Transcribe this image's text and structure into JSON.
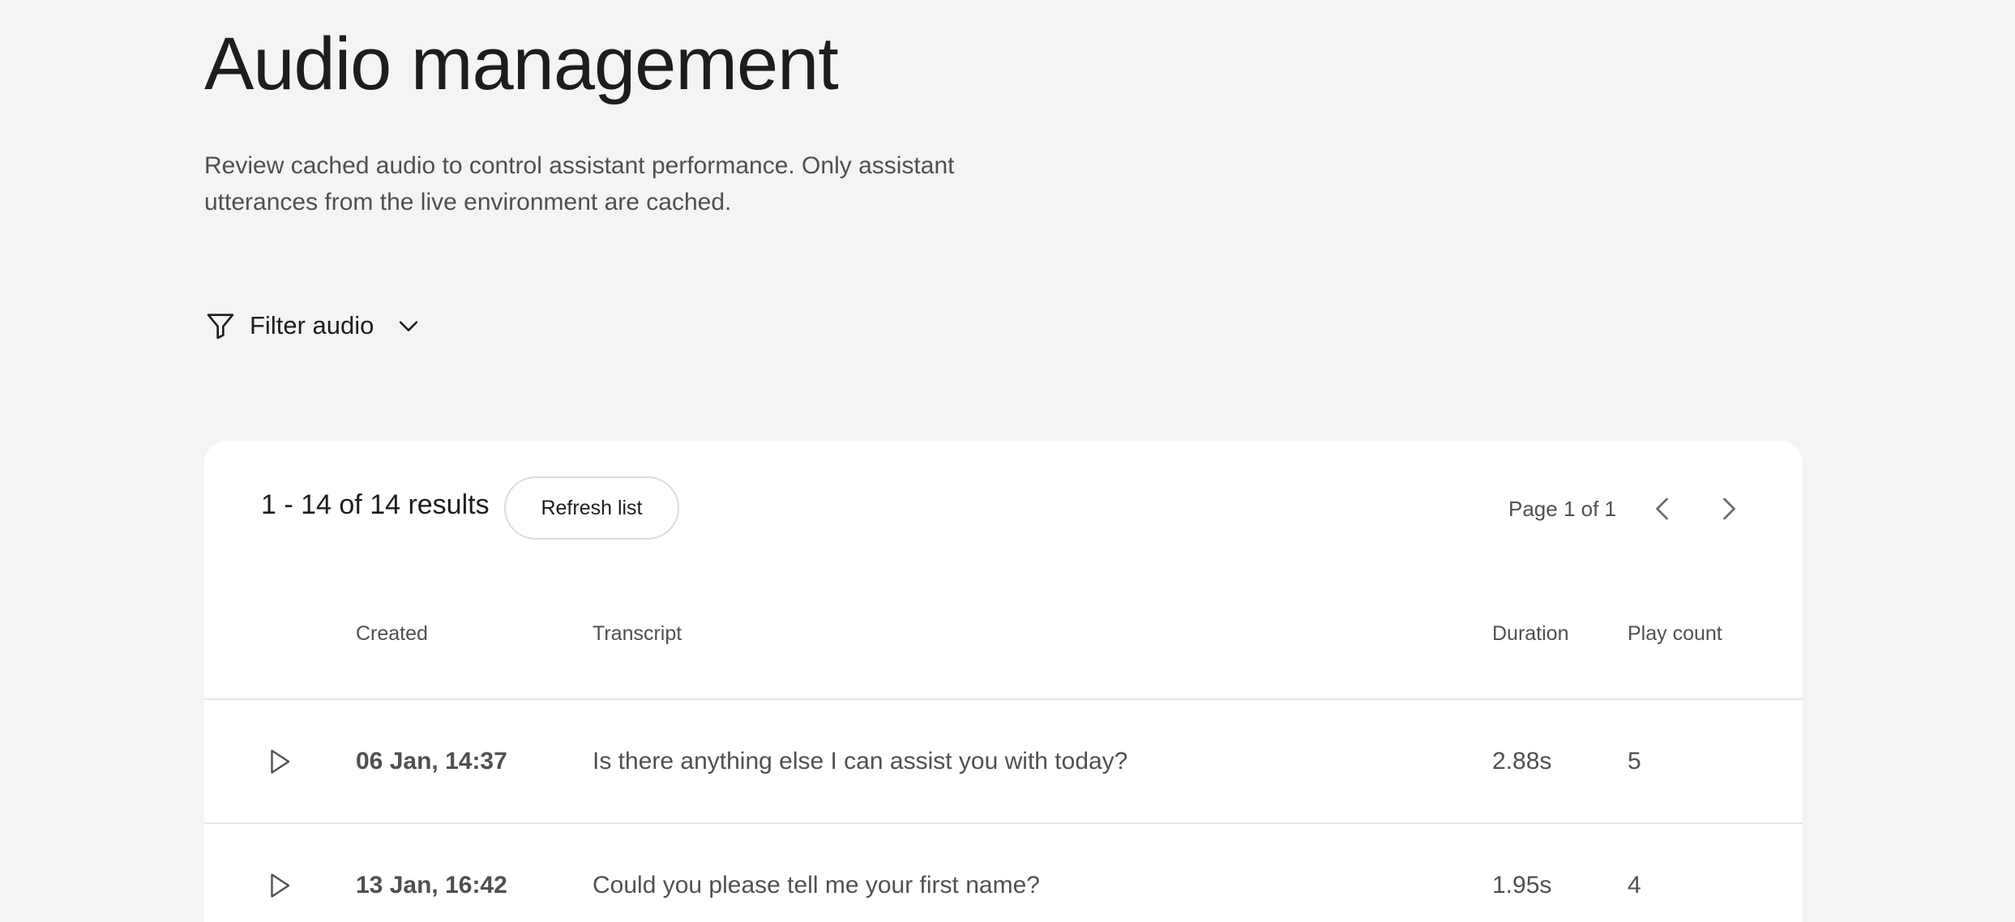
{
  "header": {
    "title": "Audio management",
    "description": "Review cached audio to control assistant performance. Only assistant utterances from the live environment are cached."
  },
  "filter": {
    "label": "Filter audio",
    "icon": "filter-icon",
    "expand_icon": "chevron-down-icon"
  },
  "results": {
    "count_label": "1 - 14 of 14 results",
    "refresh_label": "Refresh list",
    "page_label": "Page 1 of 1",
    "prev_icon": "chevron-left-icon",
    "next_icon": "chevron-right-icon"
  },
  "table": {
    "columns": {
      "created": "Created",
      "transcript": "Transcript",
      "duration": "Duration",
      "play_count": "Play count"
    },
    "rows": [
      {
        "play_icon": "play-icon",
        "created": "06 Jan, 14:37",
        "transcript": "Is there anything else I can assist you with today?",
        "duration": "2.88s",
        "play_count": "5"
      },
      {
        "play_icon": "play-icon",
        "created": "13 Jan, 16:42",
        "transcript": "Could you please tell me your first name?",
        "duration": "1.95s",
        "play_count": "4"
      }
    ]
  },
  "colors": {
    "page_background": "#f4f4f4",
    "card_background": "#ffffff",
    "primary_text": "#1d1d1d",
    "secondary_text": "#505050",
    "divider": "#e6e6e6"
  }
}
